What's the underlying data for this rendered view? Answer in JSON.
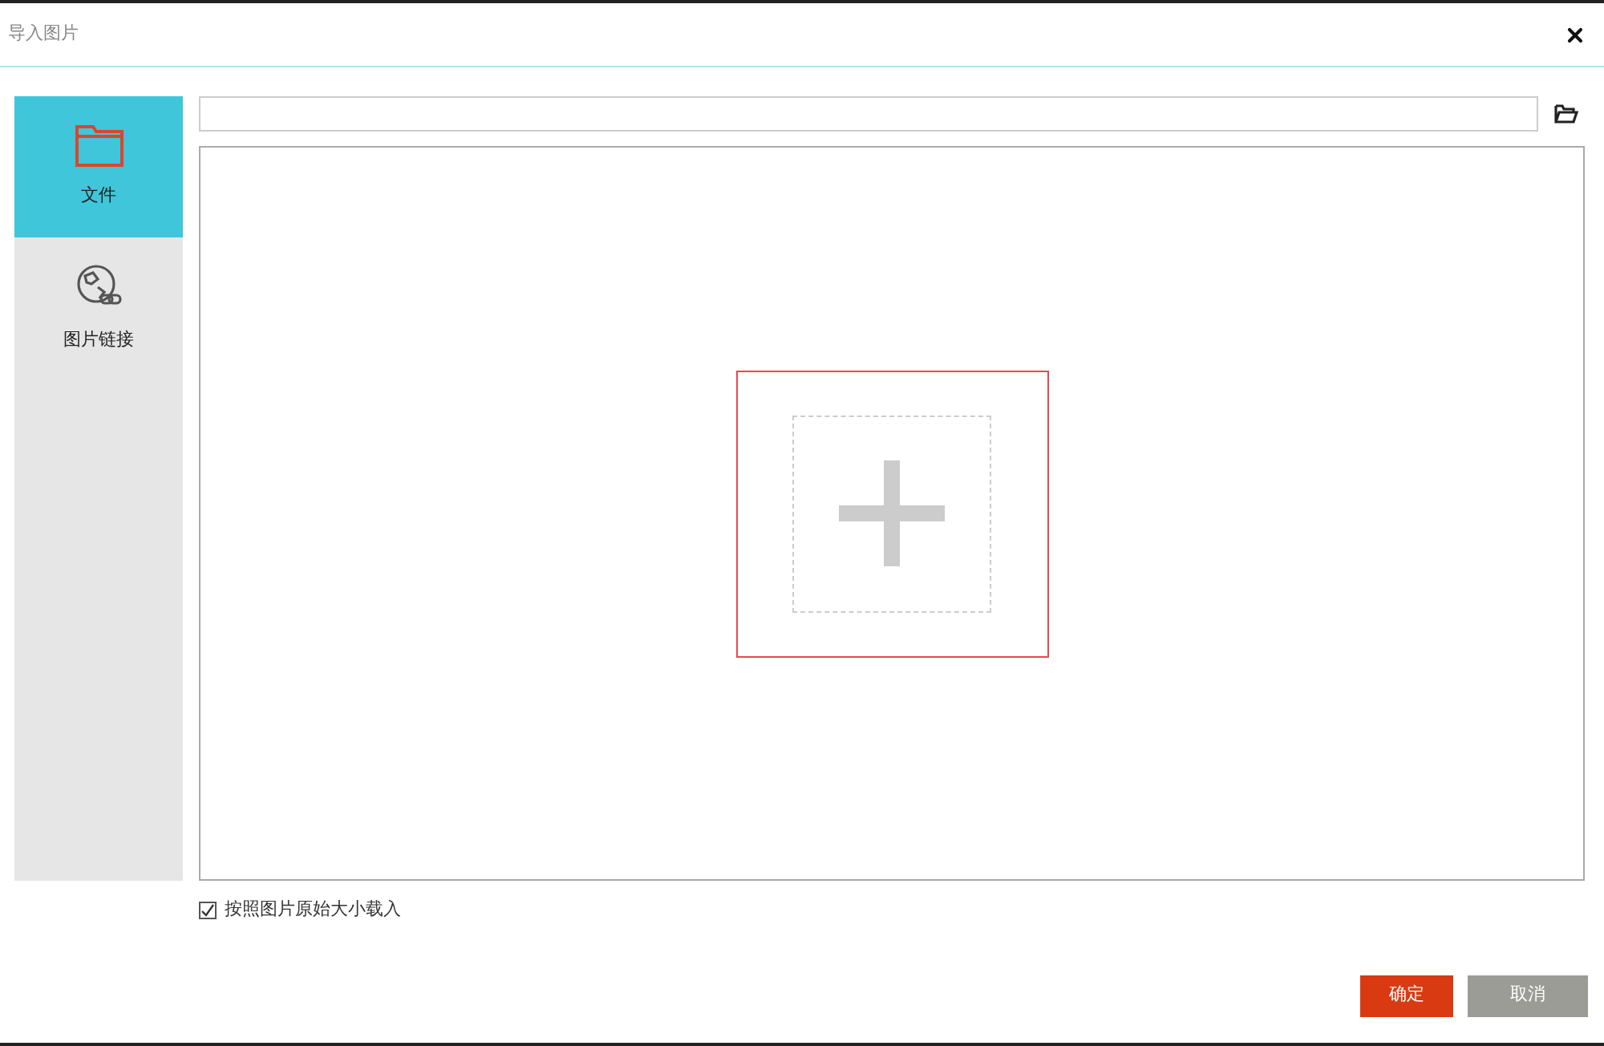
{
  "window": {
    "title": "导入图片"
  },
  "sidebar": {
    "items": [
      {
        "label": "文件",
        "kind": "file",
        "selected": true
      },
      {
        "label": "图片链接",
        "kind": "link",
        "selected": false
      }
    ]
  },
  "original_size_option": {
    "label": "按照图片原始大小载入",
    "checked": true
  },
  "buttons": [
    {
      "label": "确定",
      "kind": "primary"
    },
    {
      "label": "取消",
      "kind": "secondary"
    }
  ]
}
